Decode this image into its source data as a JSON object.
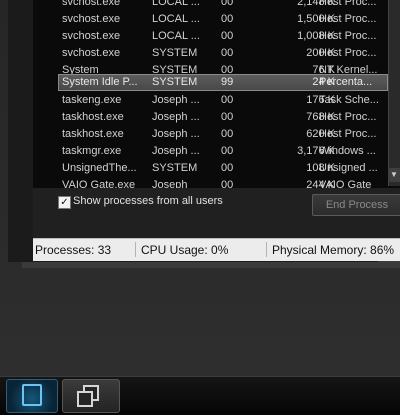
{
  "processes": [
    {
      "name": "svchost.exe",
      "user": "LOCAL ...",
      "cpu": "00",
      "mem": "2,148 K",
      "desc": "Host Proc..."
    },
    {
      "name": "svchost.exe",
      "user": "LOCAL ...",
      "cpu": "00",
      "mem": "1,500 K",
      "desc": "Host Proc..."
    },
    {
      "name": "svchost.exe",
      "user": "LOCAL ...",
      "cpu": "00",
      "mem": "1,008 K",
      "desc": "Host Proc..."
    },
    {
      "name": "svchost.exe",
      "user": "SYSTEM",
      "cpu": "00",
      "mem": "200 K",
      "desc": "Host Proc..."
    },
    {
      "name": "System",
      "user": "SYSTEM",
      "cpu": "00",
      "mem": "76 K",
      "desc": "NT Kernel..."
    },
    {
      "name": "System Idle P...",
      "user": "SYSTEM",
      "cpu": "99",
      "mem": "24 K",
      "desc": "Percenta...",
      "selected": true
    },
    {
      "name": "taskeng.exe",
      "user": "Joseph ...",
      "cpu": "00",
      "mem": "176 K",
      "desc": "Task Sche..."
    },
    {
      "name": "taskhost.exe",
      "user": "Joseph ...",
      "cpu": "00",
      "mem": "768 K",
      "desc": "Host Proc..."
    },
    {
      "name": "taskhost.exe",
      "user": "Joseph ...",
      "cpu": "00",
      "mem": "620 K",
      "desc": "Host Proc..."
    },
    {
      "name": "taskmgr.exe",
      "user": "Joseph ...",
      "cpu": "00",
      "mem": "3,176 K",
      "desc": "Windows ..."
    },
    {
      "name": "UnsignedThe...",
      "user": "SYSTEM",
      "cpu": "00",
      "mem": "108 K",
      "desc": "Unsigned ..."
    },
    {
      "name": "VAIO Gate.exe",
      "user": "Joseph",
      "cpu": "00",
      "mem": "244 K",
      "desc": "VAIO Gate"
    }
  ],
  "controls": {
    "show_all_label": "Show processes from all users",
    "show_all_checked": "✓",
    "end_process_label": "End Process"
  },
  "status": {
    "processes": "Processes: 33",
    "cpu": "CPU Usage: 0%",
    "memory": "Physical Memory: 86%"
  },
  "icons": {
    "scroll_down": "scroll-down-arrow-icon",
    "taskbar_1": "app-window-icon",
    "taskbar_2": "windows-stack-icon"
  },
  "colors": {
    "selection": "#555555",
    "statusbar": "#ececec",
    "taskbar_active": "#14577a"
  }
}
